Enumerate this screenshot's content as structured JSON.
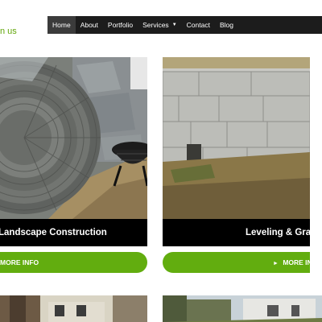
{
  "brand": {
    "tail_text": "n us"
  },
  "nav": {
    "items": [
      {
        "label": "Home",
        "active": true
      },
      {
        "label": "About"
      },
      {
        "label": "Portfolio"
      },
      {
        "label": "Services",
        "dropdown": true
      },
      {
        "label": "Contact"
      },
      {
        "label": "Blog"
      }
    ],
    "dropdown_icon": "caret-down-icon"
  },
  "cards": [
    {
      "title": "Landscape Construction",
      "button_label": "MORE INFO",
      "image_subject": "circular paver patio with fire pit"
    },
    {
      "title": "Leveling & Grac",
      "button_label": "MORE INFO",
      "image_subject": "stone block retaining wall with soil"
    }
  ],
  "button_icon": "caret-right-icon",
  "colors": {
    "accent_green": "#62ad0f",
    "nav_bg": "#1c1c1c",
    "title_bg": "#000000"
  }
}
